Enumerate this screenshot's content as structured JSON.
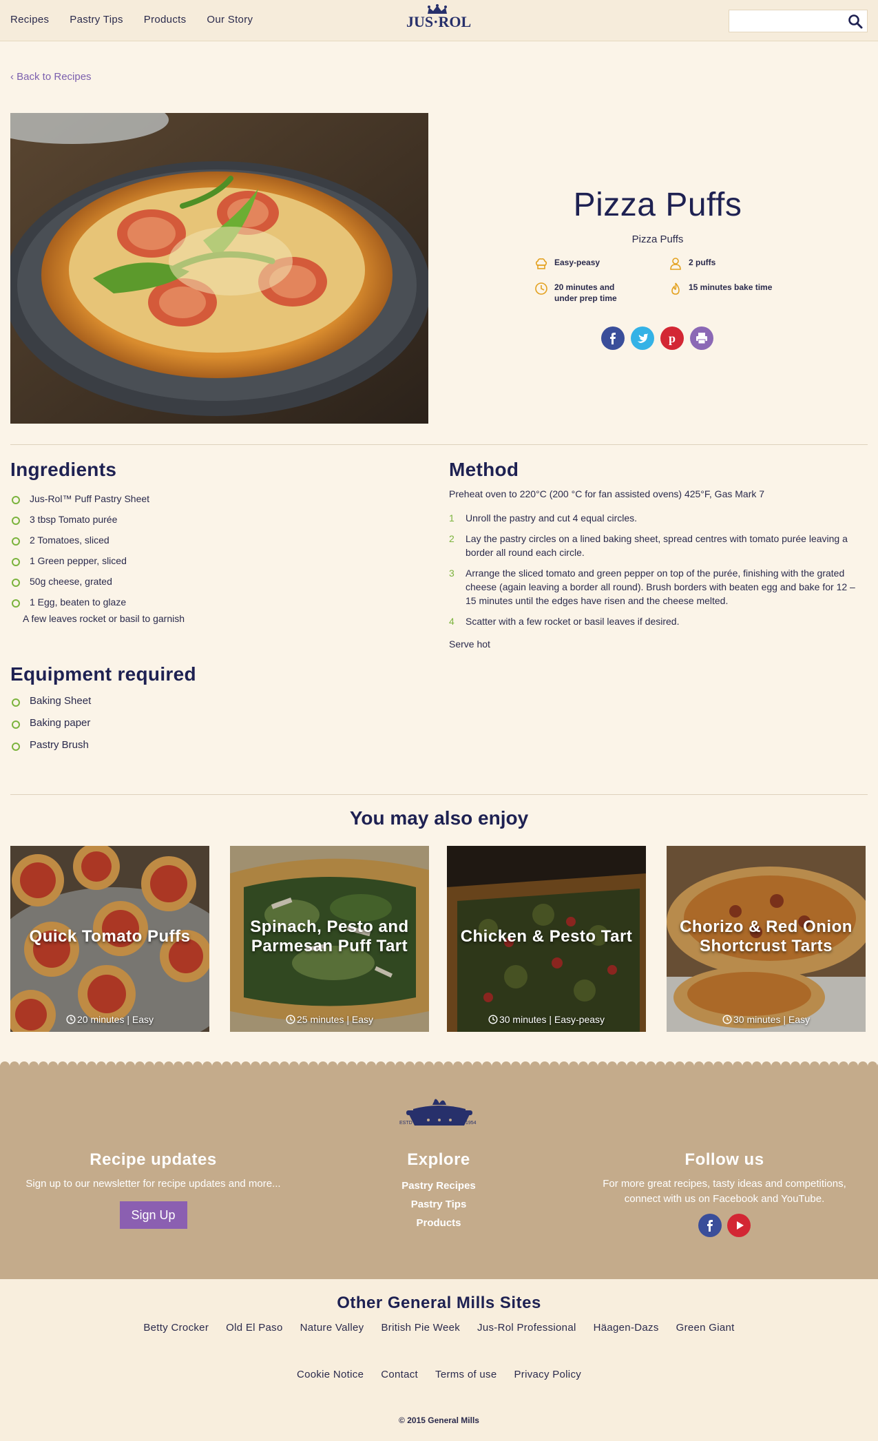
{
  "header": {
    "nav": [
      "Recipes",
      "Pastry Tips",
      "Products",
      "Our Story"
    ],
    "logo_text": "JUS·ROL",
    "search_placeholder": ""
  },
  "back_link": "Back to Recipes",
  "recipe": {
    "title": "Pizza Puffs",
    "subtitle": "Pizza Puffs",
    "meta": {
      "difficulty": "Easy-peasy",
      "serves": "2 puffs",
      "prep": "20 minutes and under prep time",
      "bake": "15 minutes bake time"
    }
  },
  "social_icons": [
    "facebook-icon",
    "twitter-icon",
    "pinterest-icon",
    "print-icon"
  ],
  "ingredients": {
    "heading": "Ingredients",
    "items": [
      "Jus-Rol™ Puff Pastry Sheet",
      "3 tbsp Tomato purée",
      "2 Tomatoes, sliced",
      "1 Green pepper, sliced",
      "50g cheese, grated",
      "1 Egg, beaten to glaze"
    ],
    "extra": "A few leaves rocket or basil to garnish"
  },
  "method": {
    "heading": "Method",
    "intro": "Preheat oven to 220°C (200 °C for fan assisted ovens) 425°F, Gas Mark 7",
    "steps": [
      {
        "num": "1",
        "text": "Unroll the pastry and cut 4 equal circles."
      },
      {
        "num": "2",
        "text": "Lay the pastry circles on a lined baking sheet, spread centres with tomato purée leaving a border all round each circle."
      },
      {
        "num": "3",
        "text": "Arrange the sliced tomato and green pepper on top of the purée, finishing with the grated cheese (again leaving a border all round). Brush borders with beaten egg and bake for 12 – 15 minutes until the edges have risen and the cheese melted."
      },
      {
        "num": "4",
        "text": "Scatter with a few rocket or basil leaves if desired."
      }
    ],
    "serve": "Serve hot"
  },
  "equipment": {
    "heading": "Equipment required",
    "items": [
      "Baking Sheet",
      "Baking paper",
      "Pastry Brush"
    ]
  },
  "related": {
    "heading": "You may also enjoy",
    "cards": [
      {
        "title": "Quick Tomato Puffs",
        "meta": "20 minutes | Easy"
      },
      {
        "title": "Spinach, Pesto and Parmesan Puff Tart",
        "meta": "25 minutes | Easy"
      },
      {
        "title": "Chicken & Pesto Tart",
        "meta": "30 minutes | Easy-peasy"
      },
      {
        "title": "Chorizo & Red Onion Shortcrust Tarts",
        "meta": "30 minutes | Easy"
      }
    ]
  },
  "footer": {
    "logo_left": "ESTD",
    "logo_right": "1954",
    "recipe_updates": {
      "heading": "Recipe updates",
      "text": "Sign up to our newsletter for recipe updates and more...",
      "button": "Sign Up"
    },
    "explore": {
      "heading": "Explore",
      "links": [
        "Pastry Recipes",
        "Pastry Tips",
        "Products"
      ]
    },
    "follow": {
      "heading": "Follow us",
      "text": "For more great recipes, tasty ideas and competitions, connect with us on Facebook and YouTube."
    }
  },
  "general_mills": {
    "heading": "Other General Mills Sites",
    "links": [
      "Betty Crocker",
      "Old El Paso",
      "Nature Valley",
      "British Pie Week",
      "Jus-Rol Professional",
      "Häagen-Dazs",
      "Green Giant"
    ]
  },
  "legal": {
    "links": [
      "Cookie Notice",
      "Contact",
      "Terms of use",
      "Privacy Policy"
    ],
    "copyright": "© 2015 General Mills"
  },
  "colors": {
    "navy": "#1e2152",
    "accent_purple": "#8b5fb1",
    "bullet_green": "#7bb33d",
    "footer_tan": "#c4ab8b",
    "page_bg": "#fbf4e8"
  }
}
